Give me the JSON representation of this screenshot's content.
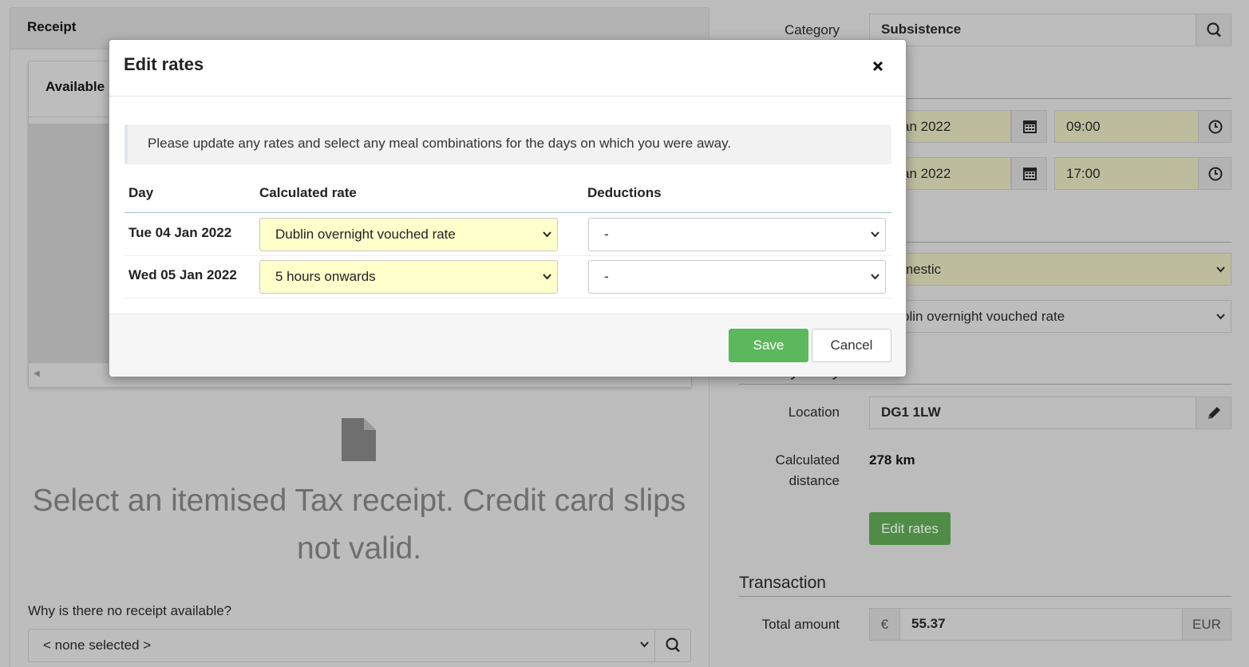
{
  "receipt": {
    "header": "Receipt",
    "available_label": "Available",
    "message": "Select an itemised Tax receipt. Credit card slips not valid.",
    "why_label": "Why is there no receipt available?",
    "why_value": "< none selected >"
  },
  "form": {
    "category_label": "Category",
    "category_value": "Subsistence",
    "start_date": "an 2022",
    "start_time": "09:00",
    "end_date": "an 2022",
    "end_time": "17:00",
    "type_value": "mestic",
    "rate_value": "blin overnight vouched rate",
    "journey_title": "Journey entry",
    "location_label": "Location",
    "location_value": "DG1 1LW",
    "distance_label_1": "Calculated",
    "distance_label_2": "distance",
    "distance_value": "278 km",
    "edit_rates_label": "Edit rates",
    "transaction_title": "Transaction",
    "total_label": "Total amount",
    "currency_symbol": "€",
    "total_value": "55.37",
    "currency_code": "EUR"
  },
  "modal": {
    "title": "Edit rates",
    "info": "Please update any rates and select any meal combinations for the days on which you were away.",
    "columns": [
      "Day",
      "Calculated rate",
      "Deductions"
    ],
    "rows": [
      {
        "day": "Tue 04 Jan 2022",
        "rate": "Dublin overnight vouched rate",
        "deduction": "-"
      },
      {
        "day": "Wed 05 Jan 2022",
        "rate": "5 hours onwards",
        "deduction": "-"
      }
    ],
    "save_label": "Save",
    "cancel_label": "Cancel"
  },
  "icons": {
    "close": "close-icon",
    "search": "search-icon",
    "calendar": "calendar-icon",
    "clock": "clock-icon",
    "pencil": "pencil-icon",
    "document": "document-icon",
    "chevron": "chevron-down-icon"
  },
  "colors": {
    "save_button": "#5cb85c",
    "highlight_select": "#ffffcc",
    "edit_rates_button": "#4f8d46"
  }
}
